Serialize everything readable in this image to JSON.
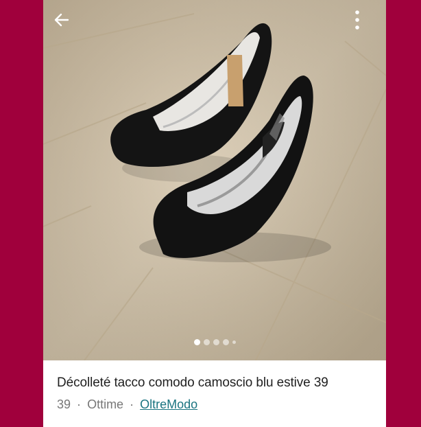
{
  "header": {
    "back_icon": "arrow-left-icon",
    "menu_icon": "vertical-dots-icon"
  },
  "gallery": {
    "image_count_dots": 5,
    "active_index": 0
  },
  "listing": {
    "title": "Décolleté tacco comodo camoscio blu estive 39",
    "size": "39",
    "separator": "·",
    "condition": "Ottime",
    "brand": "OltreModo"
  },
  "colors": {
    "background": "#a0003c",
    "brand_link": "#1a7480"
  }
}
